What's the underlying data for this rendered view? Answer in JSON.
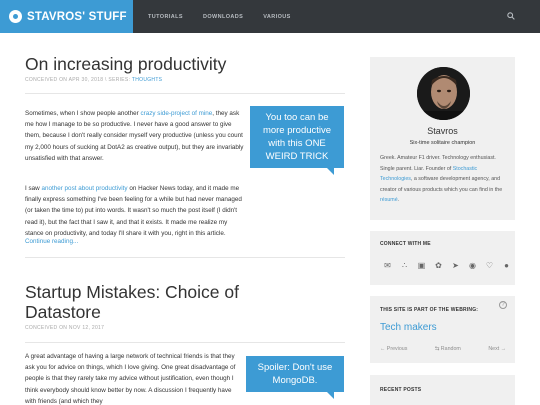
{
  "header": {
    "brand": "STAVROS' STUFF",
    "nav": [
      "TUTORIALS",
      "DOWNLOADS",
      "VARIOUS"
    ]
  },
  "posts": [
    {
      "title": "On increasing productivity",
      "meta_prefix": "CONCEIVED ON APR 30, 2018 \\ SERIES: ",
      "series": "THOUGHTS",
      "callout": "You too can be more productive with this ONE WEIRD TRICK",
      "p1_a": "Sometimes, when I show people another ",
      "p1_link": "crazy side-project of mine",
      "p1_b": ", they ask me how I manage to be so productive. I never have a good answer to give them, because I don't really consider myself very productive (unless you count my 2,000 hours of sucking at DotA2 as creative output), but they are invariably unsatisfied with that answer.",
      "p2_a": "I saw ",
      "p2_link": "another post about productivity",
      "p2_b": " on Hacker News today, and it made me finally express something I've been feeling for a while but had never managed (or taken the time to) put into words. It wasn't so much the post itself (I didn't read it), but the fact that I saw it, and that it exists. It made me realize my stance on productivity, and today I'll share it with you, right in this article.",
      "read_more": "Continue reading..."
    },
    {
      "title": "Startup Mistakes: Choice of Datastore",
      "meta": "CONCEIVED ON NOV 12, 2017",
      "callout": "Spoiler: Don't use MongoDB.",
      "p1": "A great advantage of having a large network of technical friends is that they ask you for advice on things, which I love giving. One great disadvantage of people is that they rarely take my advice without justification, even though I think everybody should know better by now. A discussion I frequently have with friends (and which they"
    }
  ],
  "sidebar": {
    "profile": {
      "name": "Stavros",
      "tagline": "Six-time solitaire champion",
      "bio_a": "Greek. Amateur F1 driver. Technology enthusiast. Single parent. Liar. Founder of ",
      "bio_link": "Stochastic Technologies",
      "bio_b": ", a software development agency, and creator of various products which you can find in the ",
      "bio_link2": "résumé",
      "bio_c": "."
    },
    "connect": {
      "title": "CONNECT WITH ME",
      "icons": [
        "email-icon",
        "rss-icon",
        "mastodon-icon",
        "twitter-icon",
        "telegram-icon",
        "github-icon",
        "heart-icon",
        "flickr-icon"
      ]
    },
    "webring": {
      "title": "THIS SITE IS PART OF THE WEBRING:",
      "name": "Tech makers",
      "prev": "Previous",
      "random": "Random",
      "next": "Next"
    },
    "recent": {
      "title": "RECENT POSTS"
    }
  },
  "colors": {
    "accent": "#3d9bd4",
    "topbar": "#34383c",
    "sidebar_bg": "#f0f0f0"
  }
}
